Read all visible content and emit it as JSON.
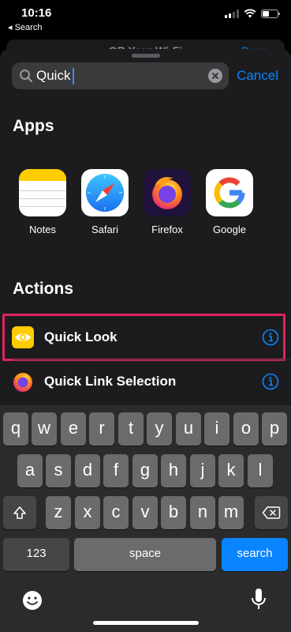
{
  "status": {
    "time": "10:16",
    "back_label": "◂ Search"
  },
  "behind_sheet": {
    "title": "QR Your Wi-Fi",
    "done": "Done"
  },
  "search": {
    "value": "Quick",
    "cancel_label": "Cancel"
  },
  "apps_section": {
    "title": "Apps",
    "items": [
      {
        "label": "Notes",
        "icon": "notes-app-icon"
      },
      {
        "label": "Safari",
        "icon": "safari-app-icon"
      },
      {
        "label": "Firefox",
        "icon": "firefox-app-icon"
      },
      {
        "label": "Google",
        "icon": "google-app-icon"
      }
    ]
  },
  "actions_section": {
    "title": "Actions",
    "items": [
      {
        "label": "Quick Look",
        "icon": "eye-icon",
        "highlighted": true
      },
      {
        "label": "Quick Link Selection",
        "icon": "firefox-icon",
        "highlighted": false
      }
    ]
  },
  "keyboard": {
    "row1": [
      "q",
      "w",
      "e",
      "r",
      "t",
      "y",
      "u",
      "i",
      "o",
      "p"
    ],
    "row2": [
      "a",
      "s",
      "d",
      "f",
      "g",
      "h",
      "j",
      "k",
      "l"
    ],
    "row3": [
      "z",
      "x",
      "c",
      "v",
      "b",
      "n",
      "m"
    ],
    "numbers_label": "123",
    "space_label": "space",
    "search_label": "search"
  },
  "colors": {
    "accent": "#0a84ff",
    "highlight": "#e0245e",
    "sheet": "#1c1c1e"
  }
}
